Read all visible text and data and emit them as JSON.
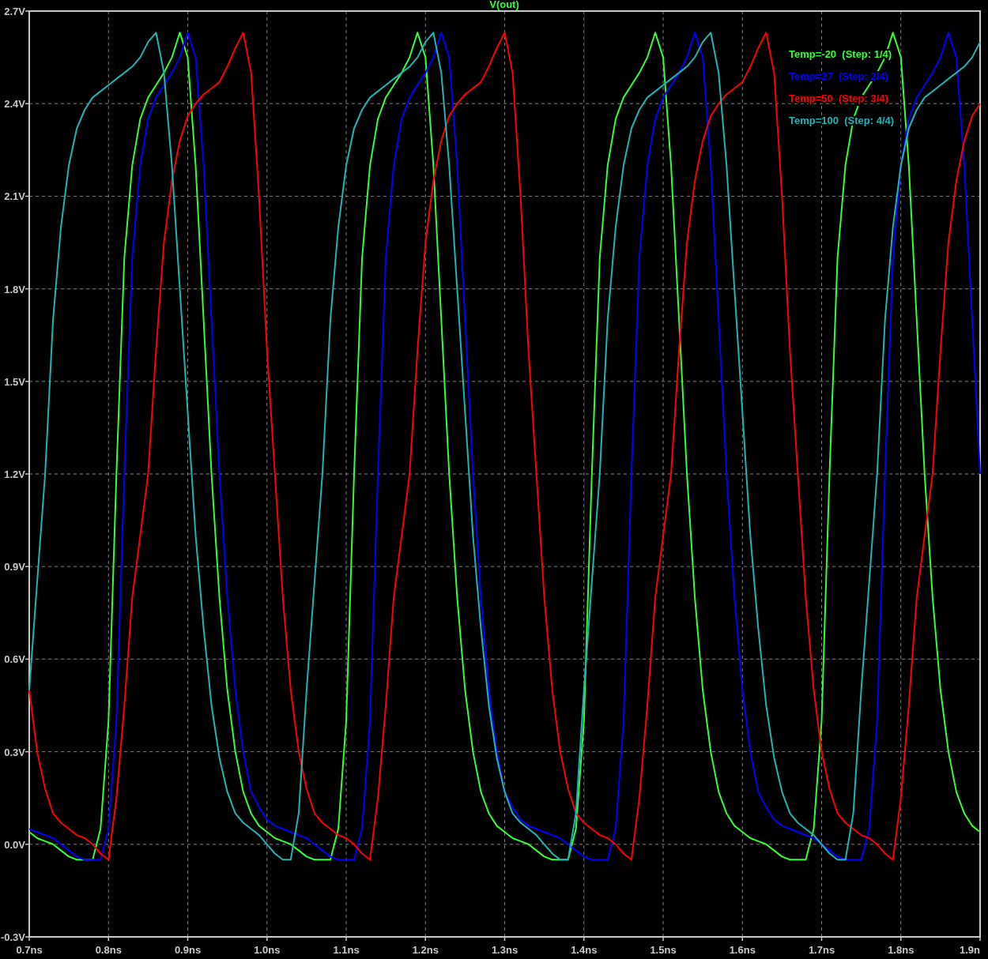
{
  "plot": {
    "chart_data": {
      "type": "line",
      "title": "V(out)",
      "grid": true,
      "xlim": [
        0.7,
        1.9
      ],
      "ylim": [
        -0.3,
        2.7
      ],
      "xticks": [
        {
          "value": 0.7,
          "label": "0.7ns"
        },
        {
          "value": 0.8,
          "label": "0.8ns"
        },
        {
          "value": 0.9,
          "label": "0.9ns"
        },
        {
          "value": 1.0,
          "label": "1.0ns"
        },
        {
          "value": 1.1,
          "label": "1.1ns"
        },
        {
          "value": 1.2,
          "label": "1.2ns"
        },
        {
          "value": 1.3,
          "label": "1.3ns"
        },
        {
          "value": 1.4,
          "label": "1.4ns"
        },
        {
          "value": 1.5,
          "label": "1.5ns"
        },
        {
          "value": 1.6,
          "label": "1.6ns"
        },
        {
          "value": 1.7,
          "label": "1.7ns"
        },
        {
          "value": 1.8,
          "label": "1.8ns"
        },
        {
          "value": 1.9,
          "label": "1.9n"
        }
      ],
      "yticks": [
        {
          "value": -0.3,
          "label": "-0.3V"
        },
        {
          "value": 0.0,
          "label": "0.0V"
        },
        {
          "value": 0.3,
          "label": "0.3V"
        },
        {
          "value": 0.6,
          "label": "0.6V"
        },
        {
          "value": 0.9,
          "label": "0.9V"
        },
        {
          "value": 1.2,
          "label": "1.2V"
        },
        {
          "value": 1.5,
          "label": "1.5V"
        },
        {
          "value": 1.8,
          "label": "1.8V"
        },
        {
          "value": 2.1,
          "label": "2.1V"
        },
        {
          "value": 2.4,
          "label": "2.4V"
        },
        {
          "value": 2.7,
          "label": "2.7V"
        }
      ],
      "x": [
        0.7,
        0.71,
        0.72,
        0.73,
        0.74,
        0.75,
        0.76,
        0.77,
        0.78,
        0.79,
        0.8,
        0.81,
        0.82,
        0.83,
        0.84,
        0.85,
        0.86,
        0.87,
        0.88,
        0.89,
        0.9,
        0.91,
        0.92,
        0.93,
        0.94,
        0.95,
        0.96,
        0.97,
        0.98,
        0.99,
        1.0,
        1.01,
        1.02,
        1.03,
        1.04,
        1.05,
        1.06,
        1.07,
        1.08,
        1.09,
        1.1,
        1.11,
        1.12,
        1.13,
        1.14,
        1.15,
        1.16,
        1.17,
        1.18,
        1.19,
        1.2,
        1.21,
        1.22,
        1.23,
        1.24,
        1.25,
        1.26,
        1.27,
        1.28,
        1.29,
        1.3,
        1.31,
        1.32,
        1.33,
        1.34,
        1.35,
        1.36,
        1.37,
        1.38,
        1.39,
        1.4,
        1.41,
        1.42,
        1.43,
        1.44,
        1.45,
        1.46,
        1.47,
        1.48,
        1.49,
        1.5,
        1.51,
        1.52,
        1.53,
        1.54,
        1.55,
        1.56,
        1.57,
        1.58,
        1.59,
        1.6,
        1.61,
        1.62,
        1.63,
        1.64,
        1.65,
        1.66,
        1.67,
        1.68,
        1.69,
        1.7,
        1.71,
        1.72,
        1.73,
        1.74,
        1.75,
        1.76,
        1.77,
        1.78,
        1.79,
        1.8,
        1.81,
        1.82,
        1.83,
        1.84,
        1.85,
        1.86,
        1.87,
        1.88,
        1.89,
        1.9
      ],
      "series": [
        {
          "name": "Temp=-20  (Step: 1/4)",
          "color": "#33ff33",
          "values": [
            0.04,
            0.02,
            0.01,
            0.0,
            -0.02,
            -0.04,
            -0.05,
            -0.05,
            -0.05,
            0.05,
            0.4,
            1.2,
            1.9,
            2.2,
            2.35,
            2.42,
            2.46,
            2.5,
            2.55,
            2.63,
            2.55,
            2.2,
            1.7,
            1.2,
            0.8,
            0.5,
            0.3,
            0.17,
            0.1,
            0.06,
            0.04,
            0.02,
            0.01,
            0.0,
            -0.02,
            -0.04,
            -0.05,
            -0.05,
            -0.05,
            0.05,
            0.4,
            1.2,
            1.9,
            2.2,
            2.35,
            2.42,
            2.46,
            2.5,
            2.55,
            2.63,
            2.55,
            2.2,
            1.7,
            1.2,
            0.8,
            0.5,
            0.3,
            0.17,
            0.1,
            0.06,
            0.04,
            0.02,
            0.01,
            0.0,
            -0.02,
            -0.04,
            -0.05,
            -0.05,
            -0.05,
            0.05,
            0.4,
            1.2,
            1.9,
            2.2,
            2.35,
            2.42,
            2.46,
            2.5,
            2.55,
            2.63,
            2.55,
            2.2,
            1.7,
            1.2,
            0.8,
            0.5,
            0.3,
            0.17,
            0.1,
            0.06,
            0.04,
            0.02,
            0.01,
            0.0,
            -0.02,
            -0.04,
            -0.05,
            -0.05,
            -0.05,
            0.05,
            0.4,
            1.2,
            1.9,
            2.2,
            2.35,
            2.42,
            2.46,
            2.5,
            2.55,
            2.63,
            2.55,
            2.2,
            1.7,
            1.2,
            0.8,
            0.5,
            0.3,
            0.17,
            0.1,
            0.06,
            0.04
          ]
        },
        {
          "name": "Temp=27  (Step: 2/4)",
          "color": "#0000ff",
          "values": [
            0.05,
            0.04,
            0.03,
            0.02,
            0.0,
            -0.02,
            -0.04,
            -0.05,
            -0.05,
            -0.05,
            0.05,
            0.4,
            1.2,
            1.9,
            2.2,
            2.35,
            2.42,
            2.46,
            2.5,
            2.55,
            2.63,
            2.55,
            2.2,
            1.7,
            1.2,
            0.8,
            0.5,
            0.3,
            0.17,
            0.12,
            0.08,
            0.06,
            0.05,
            0.04,
            0.03,
            0.02,
            0.0,
            -0.02,
            -0.04,
            -0.05,
            -0.05,
            -0.05,
            0.05,
            0.4,
            1.2,
            1.9,
            2.2,
            2.35,
            2.42,
            2.46,
            2.5,
            2.55,
            2.63,
            2.55,
            2.2,
            1.7,
            1.2,
            0.8,
            0.5,
            0.3,
            0.17,
            0.12,
            0.08,
            0.06,
            0.05,
            0.04,
            0.03,
            0.02,
            0.0,
            -0.02,
            -0.04,
            -0.05,
            -0.05,
            -0.05,
            0.05,
            0.4,
            1.2,
            1.9,
            2.2,
            2.35,
            2.42,
            2.46,
            2.5,
            2.55,
            2.63,
            2.55,
            2.2,
            1.7,
            1.2,
            0.8,
            0.5,
            0.3,
            0.17,
            0.12,
            0.08,
            0.06,
            0.05,
            0.04,
            0.03,
            0.02,
            0.0,
            -0.02,
            -0.04,
            -0.05,
            -0.05,
            -0.05,
            0.05,
            0.4,
            1.2,
            1.9,
            2.2,
            2.35,
            2.42,
            2.46,
            2.5,
            2.55,
            2.63,
            2.55,
            2.2,
            1.7,
            1.2
          ]
        },
        {
          "name": "Temp=50  (Step: 3/4)",
          "color": "#ff0000",
          "values": [
            0.5,
            0.3,
            0.18,
            0.1,
            0.07,
            0.05,
            0.03,
            0.02,
            0.0,
            -0.03,
            -0.05,
            0.15,
            0.45,
            0.8,
            1.0,
            1.2,
            1.6,
            1.95,
            2.15,
            2.28,
            2.36,
            2.4,
            2.43,
            2.45,
            2.47,
            2.52,
            2.58,
            2.63,
            2.5,
            2.1,
            1.6,
            1.2,
            0.8,
            0.5,
            0.3,
            0.18,
            0.1,
            0.07,
            0.05,
            0.03,
            0.02,
            0.0,
            -0.03,
            -0.05,
            0.15,
            0.45,
            0.8,
            1.0,
            1.2,
            1.6,
            1.95,
            2.15,
            2.28,
            2.36,
            2.4,
            2.43,
            2.45,
            2.47,
            2.52,
            2.58,
            2.63,
            2.5,
            2.1,
            1.6,
            1.2,
            0.8,
            0.5,
            0.3,
            0.18,
            0.1,
            0.07,
            0.05,
            0.03,
            0.02,
            0.0,
            -0.03,
            -0.05,
            0.15,
            0.45,
            0.8,
            1.0,
            1.2,
            1.6,
            1.95,
            2.15,
            2.28,
            2.36,
            2.4,
            2.43,
            2.45,
            2.47,
            2.52,
            2.58,
            2.63,
            2.5,
            2.1,
            1.6,
            1.2,
            0.8,
            0.5,
            0.3,
            0.18,
            0.1,
            0.07,
            0.05,
            0.03,
            0.02,
            0.0,
            -0.03,
            -0.05,
            0.15,
            0.45,
            0.8,
            1.0,
            1.2,
            1.6,
            1.95,
            2.15,
            2.28,
            2.36,
            2.4
          ]
        },
        {
          "name": "Temp=100  (Step: 4/4)",
          "color": "#20b4b4",
          "values": [
            0.5,
            0.85,
            1.2,
            1.7,
            2.0,
            2.2,
            2.32,
            2.38,
            2.42,
            2.44,
            2.46,
            2.48,
            2.5,
            2.52,
            2.55,
            2.6,
            2.63,
            2.5,
            2.2,
            1.8,
            1.4,
            1.0,
            0.7,
            0.45,
            0.28,
            0.17,
            0.1,
            0.07,
            0.05,
            0.03,
            0.0,
            -0.03,
            -0.05,
            -0.05,
            0.1,
            0.5,
            0.85,
            1.2,
            1.7,
            2.0,
            2.2,
            2.32,
            2.38,
            2.42,
            2.44,
            2.46,
            2.48,
            2.5,
            2.52,
            2.55,
            2.6,
            2.63,
            2.5,
            2.2,
            1.8,
            1.4,
            1.0,
            0.7,
            0.45,
            0.28,
            0.17,
            0.1,
            0.07,
            0.05,
            0.03,
            0.0,
            -0.03,
            -0.05,
            -0.05,
            0.1,
            0.5,
            0.85,
            1.2,
            1.7,
            2.0,
            2.2,
            2.32,
            2.38,
            2.42,
            2.44,
            2.46,
            2.48,
            2.5,
            2.52,
            2.55,
            2.6,
            2.63,
            2.5,
            2.2,
            1.8,
            1.4,
            1.0,
            0.7,
            0.45,
            0.28,
            0.17,
            0.1,
            0.07,
            0.05,
            0.03,
            0.0,
            -0.03,
            -0.05,
            -0.05,
            0.1,
            0.5,
            0.85,
            1.2,
            1.7,
            2.0,
            2.2,
            2.32,
            2.38,
            2.42,
            2.44,
            2.46,
            2.48,
            2.5,
            2.52,
            2.55,
            2.6
          ]
        }
      ]
    }
  }
}
